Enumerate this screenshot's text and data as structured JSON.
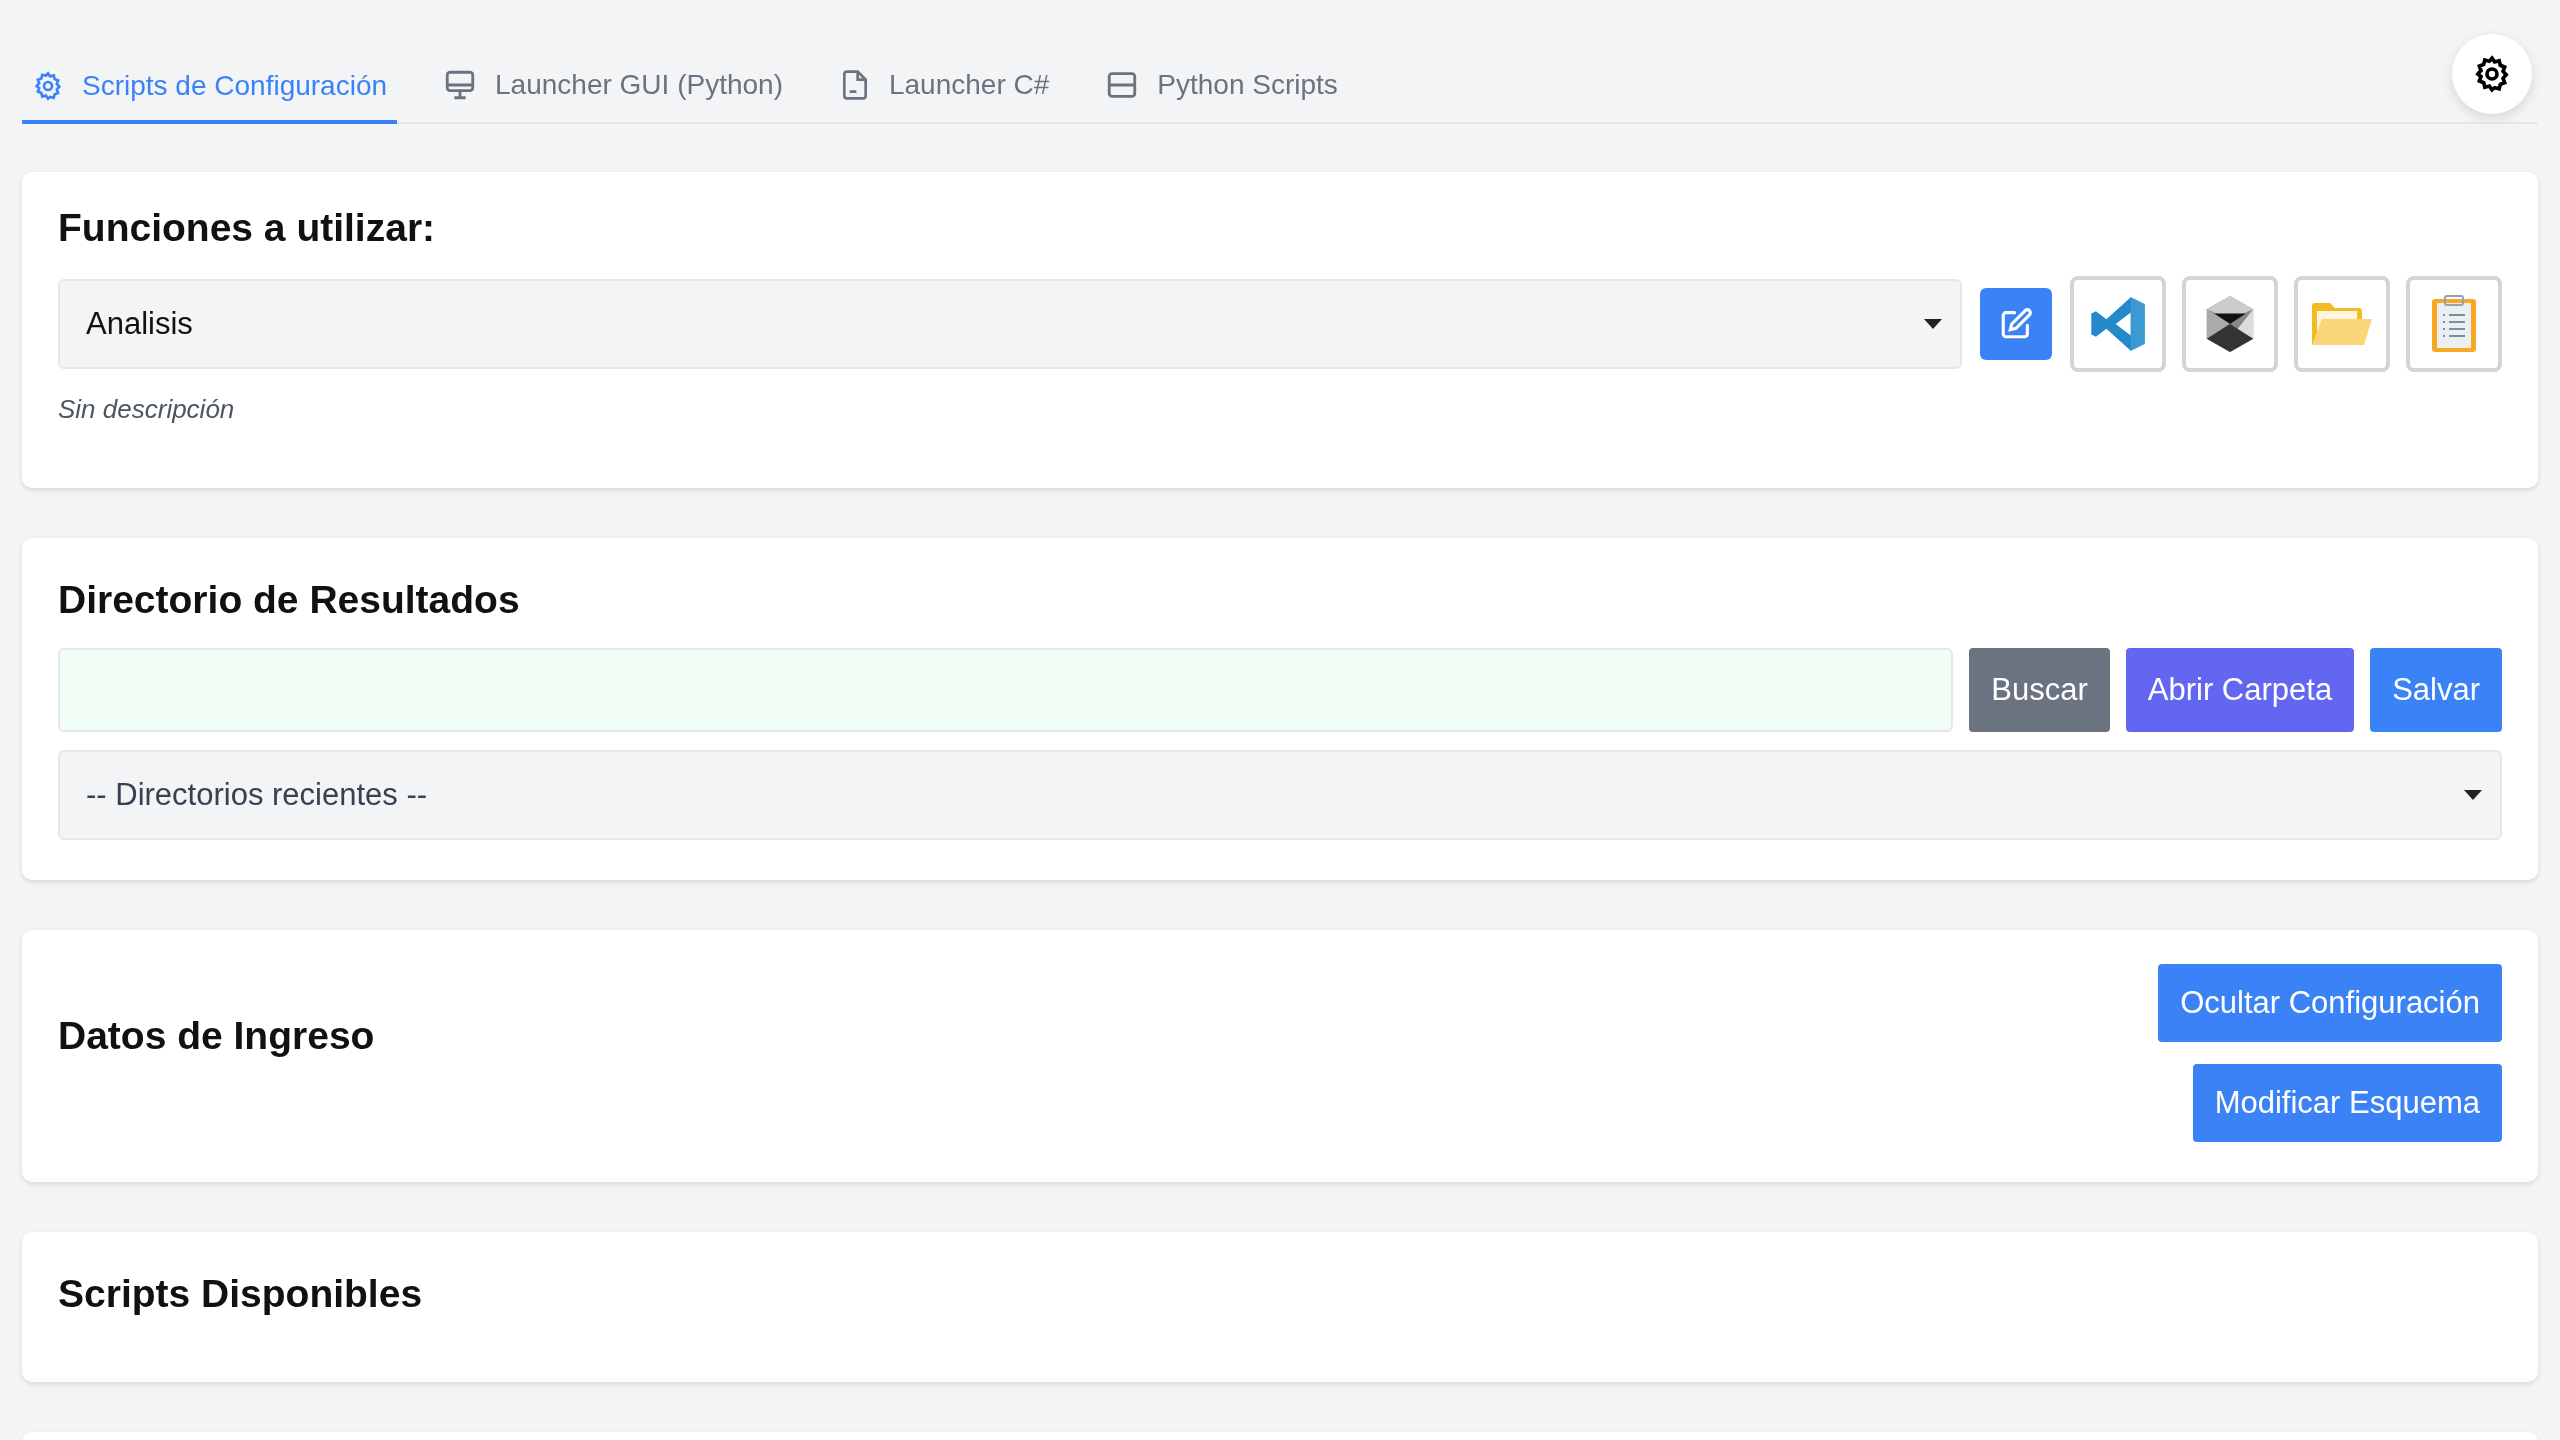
{
  "tabs": [
    {
      "label": "Scripts de Configuración",
      "selected": true
    },
    {
      "label": "Launcher GUI (Python)",
      "selected": false
    },
    {
      "label": "Launcher C#",
      "selected": false
    },
    {
      "label": "Python Scripts",
      "selected": false
    }
  ],
  "functions": {
    "title": "Funciones a utilizar:",
    "selected_value": "Analisis",
    "description": "Sin descripción"
  },
  "results": {
    "title": "Directorio de Resultados",
    "buttons": [
      {
        "label": "Buscar",
        "kind": "secondary"
      },
      {
        "label": "Abrir Carpeta",
        "kind": "accent"
      },
      {
        "label": "Salvar",
        "kind": "primary"
      }
    ],
    "recent_select": "-- Directorios recientes --"
  },
  "input_data": {
    "title": "Datos de Ingreso",
    "buttons": [
      "Ocultar Configuración",
      "Modificar Esquema"
    ]
  },
  "scripts": {
    "title": "Scripts Disponibles"
  }
}
